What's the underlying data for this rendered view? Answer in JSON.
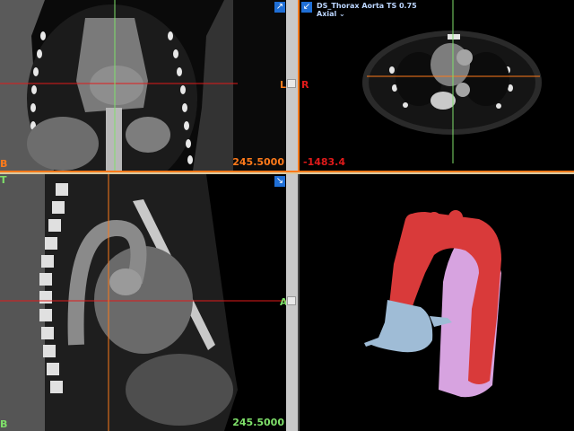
{
  "panes": {
    "coronal": {
      "orient_left": "L",
      "orient_bottom": "B",
      "wl_value": "245.5000",
      "corner_icon": "expand-arrow-icon",
      "accent": "#ff7a1a"
    },
    "axial": {
      "series_title": "DS_Thorax Aorta TS 0.75",
      "view_name": "Axial",
      "orient_right": "R",
      "wl_value": "-1483.4",
      "accent": "#e01a1a"
    },
    "sagittal": {
      "orient_top": "T",
      "orient_right": "A",
      "orient_bottom": "B",
      "wl_value": "245.5000",
      "corner_icon": "expand-arrow-icon",
      "accent": "#7fe06a"
    },
    "volume": {
      "colors": {
        "aorta": "#d93a3a",
        "pulmonary": "#9fbcd6",
        "lumen": "#d7a3e0"
      }
    }
  }
}
